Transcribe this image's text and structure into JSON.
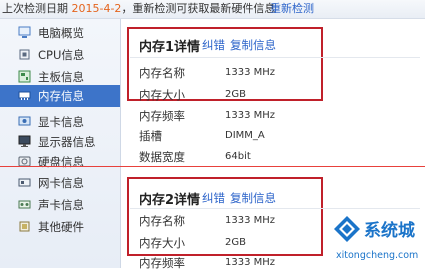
{
  "header": {
    "prefix": "上次检测日期",
    "date": "2015-4-2",
    "message": "，重新检测可获取最新硬件信息",
    "recheck_label": "重新检测"
  },
  "sidebar": {
    "items": [
      {
        "label": "电脑概览",
        "icon": "monitor-icon",
        "active": false
      },
      {
        "label": "CPU信息",
        "icon": "cpu-icon",
        "active": false
      },
      {
        "label": "主板信息",
        "icon": "motherboard-icon",
        "active": false
      },
      {
        "label": "内存信息",
        "icon": "memory-icon",
        "active": true
      },
      {
        "label": "显卡信息",
        "icon": "graphics-card-icon",
        "active": false
      },
      {
        "label": "显示器信息",
        "icon": "display-icon",
        "active": false
      },
      {
        "label": "硬盘信息",
        "icon": "harddisk-icon",
        "active": false
      },
      {
        "label": "网卡信息",
        "icon": "network-card-icon",
        "active": false
      },
      {
        "label": "声卡信息",
        "icon": "sound-card-icon",
        "active": false
      },
      {
        "label": "其他硬件",
        "icon": "other-hardware-icon",
        "active": false
      }
    ]
  },
  "memory1": {
    "title": "内存1详情",
    "link_fix": "纠错",
    "link_copy": "复制信息",
    "rows": [
      {
        "label": "内存名称",
        "value": "1333 MHz"
      },
      {
        "label": "内存大小",
        "value": "2GB"
      },
      {
        "label": "内存频率",
        "value": "1333 MHz"
      },
      {
        "label": "插槽",
        "value": "DIMM_A"
      },
      {
        "label": "数据宽度",
        "value": "64bit"
      }
    ]
  },
  "memory2": {
    "title": "内存2详情",
    "link_fix": "纠错",
    "link_copy": "复制信息",
    "rows": [
      {
        "label": "内存名称",
        "value": "1333 MHz"
      },
      {
        "label": "内存大小",
        "value": "2GB"
      },
      {
        "label": "内存频率",
        "value": "1333 MHz"
      }
    ]
  },
  "watermark": {
    "brand": "系统城",
    "url": "xitongcheng.com"
  },
  "colors": {
    "accent": "#3d74c9",
    "highlight_box": "#c0202a",
    "date": "#e4641d",
    "link": "#2a62c9"
  }
}
